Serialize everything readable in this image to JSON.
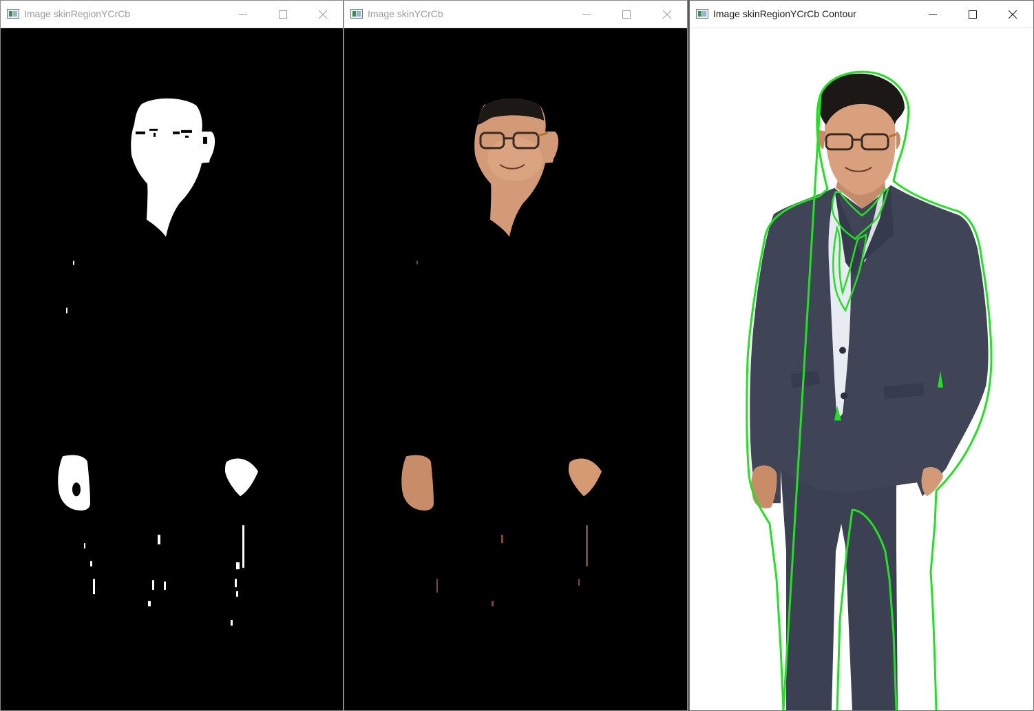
{
  "windows": [
    {
      "title": "Image skinRegionYCrCb",
      "active": false,
      "view": "skin mask"
    },
    {
      "title": "Image skinYCrCb",
      "active": false,
      "view": "skin extracted"
    },
    {
      "title": "Image skinRegionYCrCb Contour",
      "active": true,
      "view": "contour overlay"
    }
  ],
  "icons": {
    "app": "image-window-icon",
    "minimize": "minimize-icon",
    "maximize": "maximize-icon",
    "close": "close-icon"
  },
  "colors": {
    "mask_background": "#000000",
    "mask_foreground": "#ffffff",
    "contour": "#22e022",
    "suit": "#3f4557",
    "skin": "#d8a27e",
    "hair": "#1c1816"
  }
}
